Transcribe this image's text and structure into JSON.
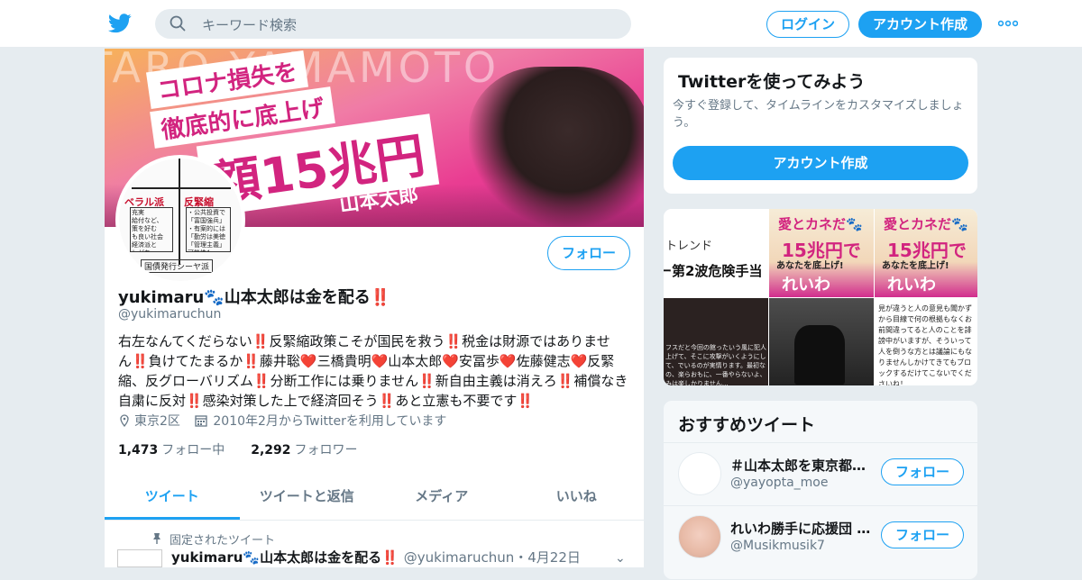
{
  "header": {
    "search_placeholder": "キーワード検索",
    "login_label": "ログイン",
    "signup_label": "アカウント作成",
    "more_icon": "more-icon"
  },
  "profile": {
    "banner_bg_text": "TARO YAMAMOTO",
    "banner_line1": "コロナ損失を",
    "banner_line2": "徹底的に底上げ",
    "banner_amount": "額15兆円",
    "banner_name": "山本太郎",
    "avatar_left_label": "ベラル派",
    "avatar_right_label": "反緊縮",
    "avatar_left_box": "充実\n給付など、\n策を好む\nも良い社会\n経済派と\nしがち",
    "avatar_right_box": "・公共投資で\n「富国強兵」\n・有案的には\n「勤労は美徳\n「管理主義」\n可能性も",
    "avatar_footer": "国債発行シーヤ派",
    "follow_label": "フォロー",
    "display_name": "yukimaru🐾山本太郎は金を配る‼️",
    "handle": "@yukimaruchun",
    "bio": "右左なんてくだらない‼️反緊縮政策こそが国民を救う‼️税金は財源ではありません‼️負けてたまるか‼️藤井聡❤️三橋貴明❤️山本太郎❤️安冨歩❤️佐藤健志❤️反緊縮、反グローバリズム‼️分断工作には乗りません‼️新自由主義は消えろ‼️補償なき自粛に反対‼️感染対策した上で経済回そう‼️あと立憲も不要です‼️",
    "location": "東京2区",
    "joined": "2010年2月からTwitterを利用しています",
    "following_count": "1,473",
    "following_label": "フォロー中",
    "followers_count": "2,292",
    "followers_label": "フォロワー",
    "tabs": [
      "ツイート",
      "ツイートと返信",
      "メディア",
      "いいね"
    ],
    "pinned_label": "固定されたツイート",
    "tweet_name": "yukimaru🐾山本太郎は金を配る‼️",
    "tweet_handle": "@yukimaruchun",
    "tweet_date": "・4月22日"
  },
  "sidebar": {
    "try_title": "Twitterを使ってみよう",
    "try_text": "今すぐ登録して、タイムラインをカスタマイズしましょう。",
    "try_button": "アカウント作成",
    "media": {
      "t1_a": "トレンド",
      "t1_b": "ー第2波危険手当",
      "ai": "愛とカネだ🐾",
      "jp": "15兆円で",
      "ana": "あなたを底上げ!",
      "rei": "れいわ",
      "t4_text": "フスだと今回の館ったいう風に犯人上げて、そこに攻撃がいくようにして、でいるのが実情ります。最初なの、楽らおもに、一番やらないよ、みは楽しかりません…",
      "t6_text": "見が違うと人の意見も聞かずから目線で何の根拠もなくお前間違ってると人のことを誹謗中がいますが、そういって人を倒うな方とは議論にもなりませんしかけてきてもブロックするだけてこないでくださいね！"
    },
    "rec_title": "おすすめツイート",
    "rec": [
      {
        "name": "＃山本太郎を東京都知事に",
        "handle": "@yayopta_moe",
        "button": "フォロー"
      },
      {
        "name": "れいわ勝手に応援団 🐾",
        "handle": "@Musikmusik7",
        "button": "フォロー"
      }
    ]
  },
  "colors": {
    "accent": "#1da1f2",
    "background": "#e6ecf0",
    "text_secondary": "#657786"
  }
}
